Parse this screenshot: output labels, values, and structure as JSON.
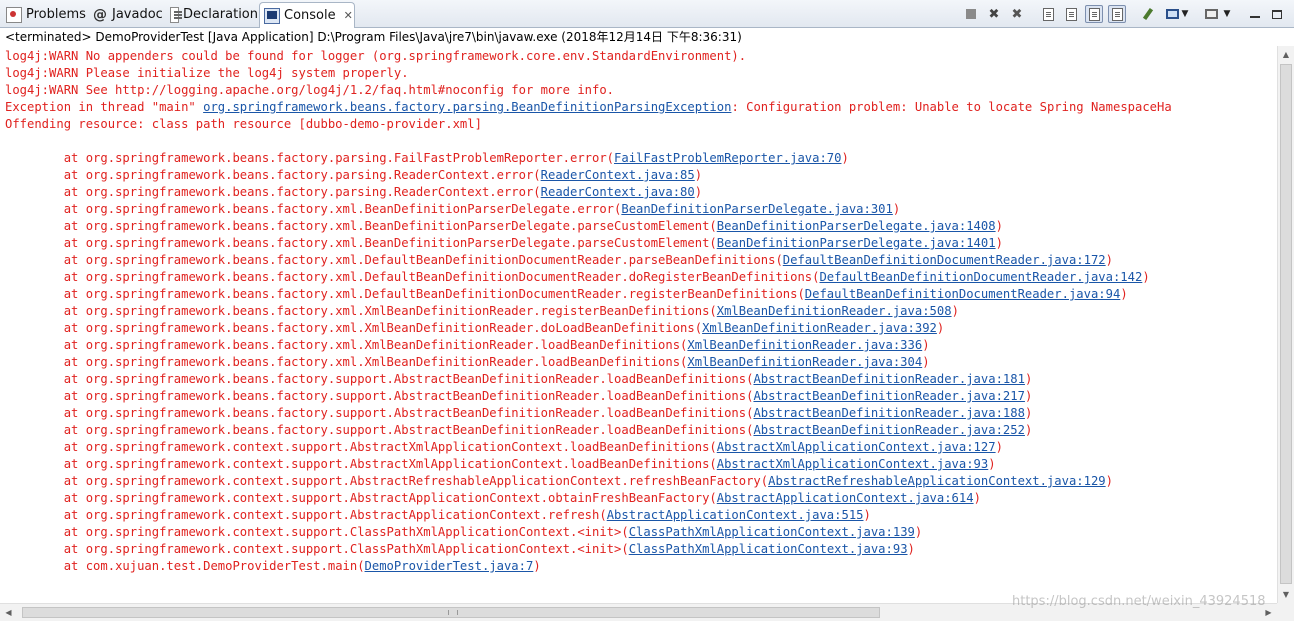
{
  "tabs": [
    {
      "label": "Problems",
      "icon": "problems-icon",
      "active": false
    },
    {
      "label": "Javadoc",
      "icon": "javadoc-icon",
      "active": false
    },
    {
      "label": "Declaration",
      "icon": "declaration-icon",
      "active": false
    },
    {
      "label": "Console",
      "icon": "console-icon",
      "active": true,
      "close": "✕"
    }
  ],
  "toolbar": {
    "icons": [
      "terminate-icon",
      "remove-launch-icon",
      "remove-all-terminated-icon",
      "clear-console-icon",
      "scroll-lock-icon",
      "word-wrap-icon",
      "show-on-stdout-icon",
      "show-on-stderr-icon",
      "pin-console-icon",
      "display-console-icon",
      "display-console-dropdown-icon",
      "open-console-icon",
      "open-console-dropdown-icon",
      "minimize-icon",
      "maximize-icon"
    ]
  },
  "status": "<terminated> DemoProviderTest [Java Application] D:\\Program Files\\Java\\jre7\\bin\\javaw.exe (2018年12月14日 下午8:36:31)",
  "console": {
    "lines": [
      {
        "text": "log4j:WARN No appenders could be found for logger (org.springframework.core.env.StandardEnvironment).",
        "link": "",
        "suffix": ""
      },
      {
        "text": "log4j:WARN Please initialize the log4j system properly.",
        "link": "",
        "suffix": ""
      },
      {
        "text": "log4j:WARN See http://logging.apache.org/log4j/1.2/faq.html#noconfig for more info.",
        "link": "",
        "suffix": ""
      },
      {
        "text": "Exception in thread \"main\" ",
        "link": "org.springframework.beans.factory.parsing.BeanDefinitionParsingException",
        "suffix": ": Configuration problem: Unable to locate Spring NamespaceHa"
      },
      {
        "text": "Offending resource: class path resource [dubbo-demo-provider.xml]",
        "link": "",
        "suffix": ""
      },
      {
        "text": "",
        "link": "",
        "suffix": ""
      },
      {
        "text": "\tat org.springframework.beans.factory.parsing.FailFastProblemReporter.error(",
        "link": "FailFastProblemReporter.java:70",
        "suffix": ")"
      },
      {
        "text": "\tat org.springframework.beans.factory.parsing.ReaderContext.error(",
        "link": "ReaderContext.java:85",
        "suffix": ")"
      },
      {
        "text": "\tat org.springframework.beans.factory.parsing.ReaderContext.error(",
        "link": "ReaderContext.java:80",
        "suffix": ")"
      },
      {
        "text": "\tat org.springframework.beans.factory.xml.BeanDefinitionParserDelegate.error(",
        "link": "BeanDefinitionParserDelegate.java:301",
        "suffix": ")"
      },
      {
        "text": "\tat org.springframework.beans.factory.xml.BeanDefinitionParserDelegate.parseCustomElement(",
        "link": "BeanDefinitionParserDelegate.java:1408",
        "suffix": ")"
      },
      {
        "text": "\tat org.springframework.beans.factory.xml.BeanDefinitionParserDelegate.parseCustomElement(",
        "link": "BeanDefinitionParserDelegate.java:1401",
        "suffix": ")"
      },
      {
        "text": "\tat org.springframework.beans.factory.xml.DefaultBeanDefinitionDocumentReader.parseBeanDefinitions(",
        "link": "DefaultBeanDefinitionDocumentReader.java:172",
        "suffix": ")"
      },
      {
        "text": "\tat org.springframework.beans.factory.xml.DefaultBeanDefinitionDocumentReader.doRegisterBeanDefinitions(",
        "link": "DefaultBeanDefinitionDocumentReader.java:142",
        "suffix": ")"
      },
      {
        "text": "\tat org.springframework.beans.factory.xml.DefaultBeanDefinitionDocumentReader.registerBeanDefinitions(",
        "link": "DefaultBeanDefinitionDocumentReader.java:94",
        "suffix": ")"
      },
      {
        "text": "\tat org.springframework.beans.factory.xml.XmlBeanDefinitionReader.registerBeanDefinitions(",
        "link": "XmlBeanDefinitionReader.java:508",
        "suffix": ")"
      },
      {
        "text": "\tat org.springframework.beans.factory.xml.XmlBeanDefinitionReader.doLoadBeanDefinitions(",
        "link": "XmlBeanDefinitionReader.java:392",
        "suffix": ")"
      },
      {
        "text": "\tat org.springframework.beans.factory.xml.XmlBeanDefinitionReader.loadBeanDefinitions(",
        "link": "XmlBeanDefinitionReader.java:336",
        "suffix": ")"
      },
      {
        "text": "\tat org.springframework.beans.factory.xml.XmlBeanDefinitionReader.loadBeanDefinitions(",
        "link": "XmlBeanDefinitionReader.java:304",
        "suffix": ")"
      },
      {
        "text": "\tat org.springframework.beans.factory.support.AbstractBeanDefinitionReader.loadBeanDefinitions(",
        "link": "AbstractBeanDefinitionReader.java:181",
        "suffix": ")"
      },
      {
        "text": "\tat org.springframework.beans.factory.support.AbstractBeanDefinitionReader.loadBeanDefinitions(",
        "link": "AbstractBeanDefinitionReader.java:217",
        "suffix": ")"
      },
      {
        "text": "\tat org.springframework.beans.factory.support.AbstractBeanDefinitionReader.loadBeanDefinitions(",
        "link": "AbstractBeanDefinitionReader.java:188",
        "suffix": ")"
      },
      {
        "text": "\tat org.springframework.beans.factory.support.AbstractBeanDefinitionReader.loadBeanDefinitions(",
        "link": "AbstractBeanDefinitionReader.java:252",
        "suffix": ")"
      },
      {
        "text": "\tat org.springframework.context.support.AbstractXmlApplicationContext.loadBeanDefinitions(",
        "link": "AbstractXmlApplicationContext.java:127",
        "suffix": ")"
      },
      {
        "text": "\tat org.springframework.context.support.AbstractXmlApplicationContext.loadBeanDefinitions(",
        "link": "AbstractXmlApplicationContext.java:93",
        "suffix": ")"
      },
      {
        "text": "\tat org.springframework.context.support.AbstractRefreshableApplicationContext.refreshBeanFactory(",
        "link": "AbstractRefreshableApplicationContext.java:129",
        "suffix": ")"
      },
      {
        "text": "\tat org.springframework.context.support.AbstractApplicationContext.obtainFreshBeanFactory(",
        "link": "AbstractApplicationContext.java:614",
        "suffix": ")"
      },
      {
        "text": "\tat org.springframework.context.support.AbstractApplicationContext.refresh(",
        "link": "AbstractApplicationContext.java:515",
        "suffix": ")"
      },
      {
        "text": "\tat org.springframework.context.support.ClassPathXmlApplicationContext.<init>(",
        "link": "ClassPathXmlApplicationContext.java:139",
        "suffix": ")"
      },
      {
        "text": "\tat org.springframework.context.support.ClassPathXmlApplicationContext.<init>(",
        "link": "ClassPathXmlApplicationContext.java:93",
        "suffix": ")"
      },
      {
        "text": "\tat com.xujuan.test.DemoProviderTest.main(",
        "link": "DemoProviderTest.java:7",
        "suffix": ")"
      }
    ]
  },
  "colors": {
    "error_text": "#e0221f",
    "link": "#1a56a8"
  },
  "watermark": "https://blog.csdn.net/weixin_43924518"
}
